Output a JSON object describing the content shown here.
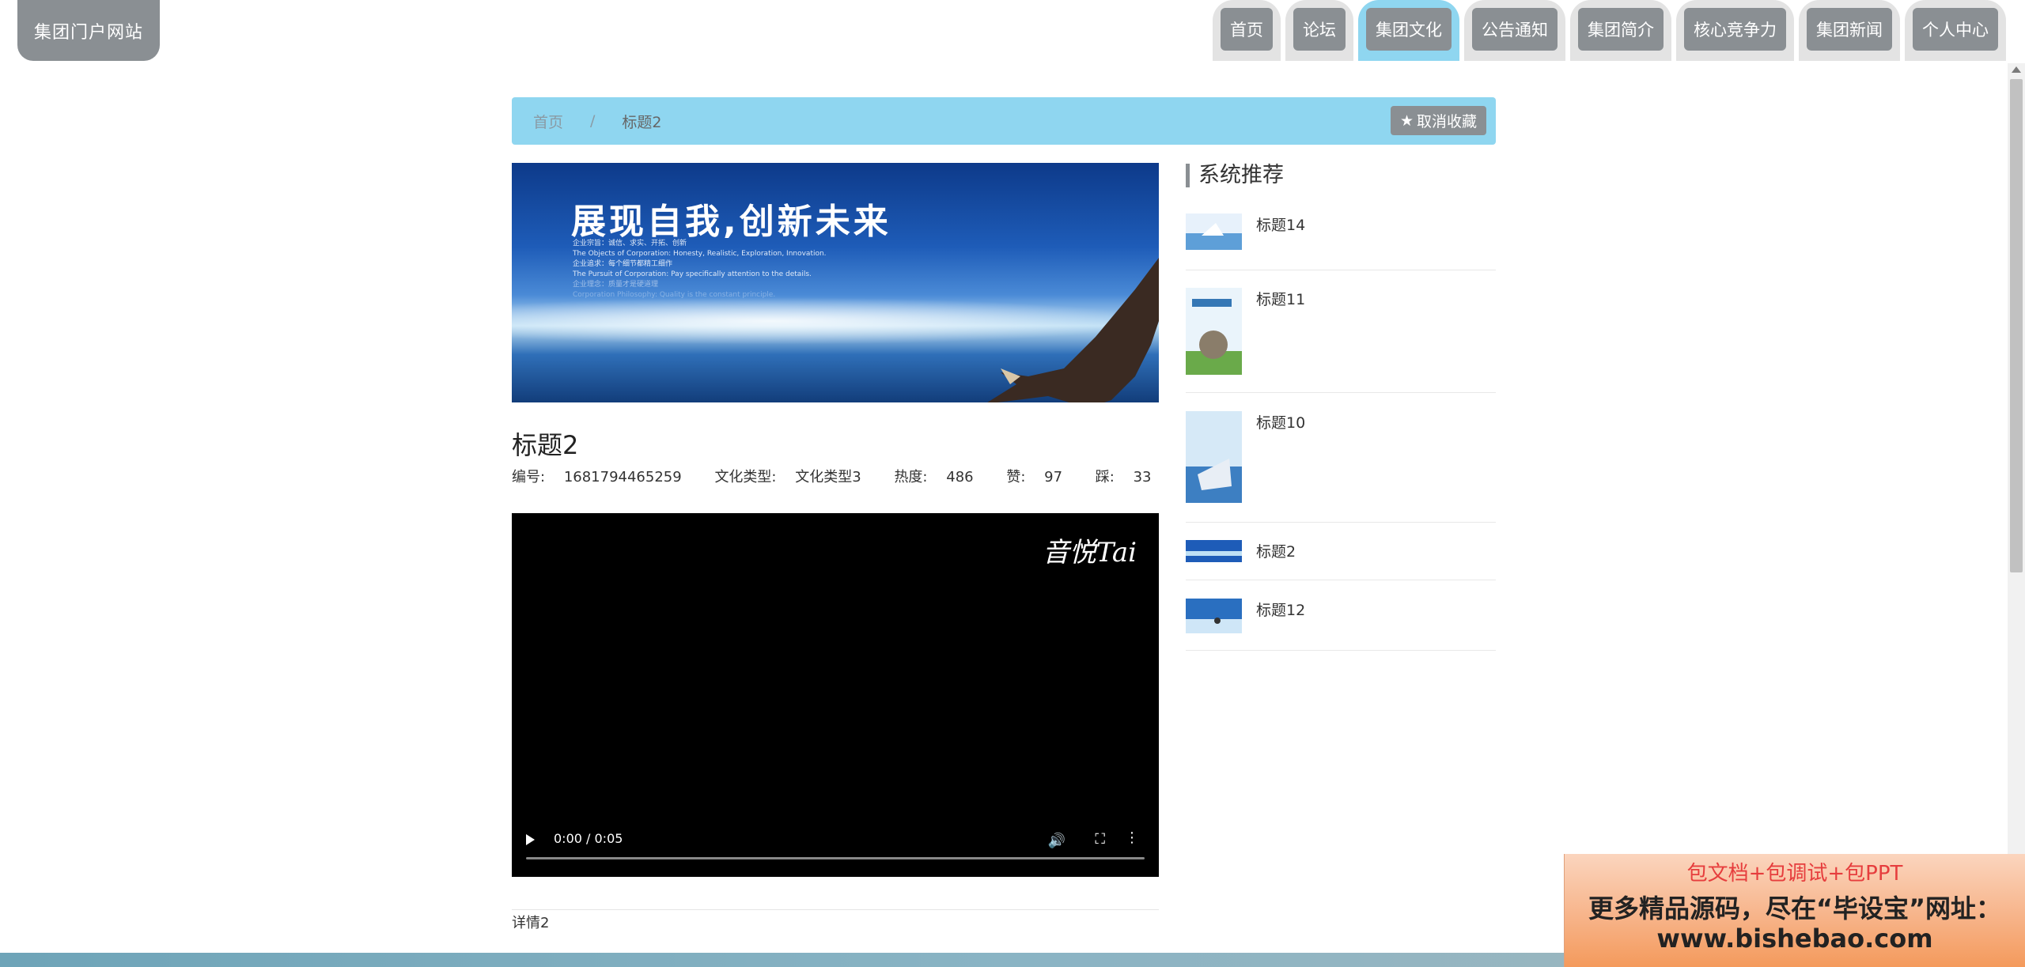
{
  "header": {
    "logo_text": "集团门户网站",
    "nav": [
      "首页",
      "论坛",
      "集团文化",
      "公告通知",
      "集团简介",
      "核心竞争力",
      "集团新闻",
      "个人中心"
    ],
    "active_nav": "集团文化"
  },
  "breadcrumb": {
    "home": "首页",
    "separator": "/",
    "current": "标题2",
    "favorite_button": "取消收藏",
    "favorite_icon": "star-icon"
  },
  "banner": {
    "headline": "展现自我,创新未来",
    "lines": [
      "企业宗旨：诚信、求实、开拓、创新",
      "The Objects of Corporation: Honesty, Realistic, Exploration, Innovation.",
      "企业追求：每个细节都精工细作",
      "The Pursuit of Corporation: Pay specifically attention to the details.",
      "企业理念：质量才是硬道理",
      "Corporation Philosophy: Quality is the constant principle."
    ]
  },
  "article": {
    "title": "标题2",
    "meta": {
      "id_label": "编号:",
      "id_value": "1681794465259",
      "type_label": "文化类型:",
      "type_value": "文化类型3",
      "heat_label": "热度:",
      "heat_value": "486",
      "like_label": "赞:",
      "like_value": "97",
      "dislike_label": "踩:",
      "dislike_value": "33"
    },
    "video": {
      "watermark": "音悦Tai",
      "time": "0:00 / 0:05",
      "progress": 0
    },
    "detail": "详情2"
  },
  "sidebar": {
    "title": "系统推荐",
    "items": [
      {
        "label": "标题14"
      },
      {
        "label": "标题11"
      },
      {
        "label": "标题10"
      },
      {
        "label": "标题2"
      },
      {
        "label": "标题12"
      }
    ]
  },
  "promo": {
    "line1": "包文档+包调试+包PPT",
    "line2": "更多精品源码，尽在“毕设宝”网址：",
    "line3": "www.bishebao.com"
  },
  "colors": {
    "accent": "#8fd6f0",
    "button_gray": "#8a8f93"
  }
}
